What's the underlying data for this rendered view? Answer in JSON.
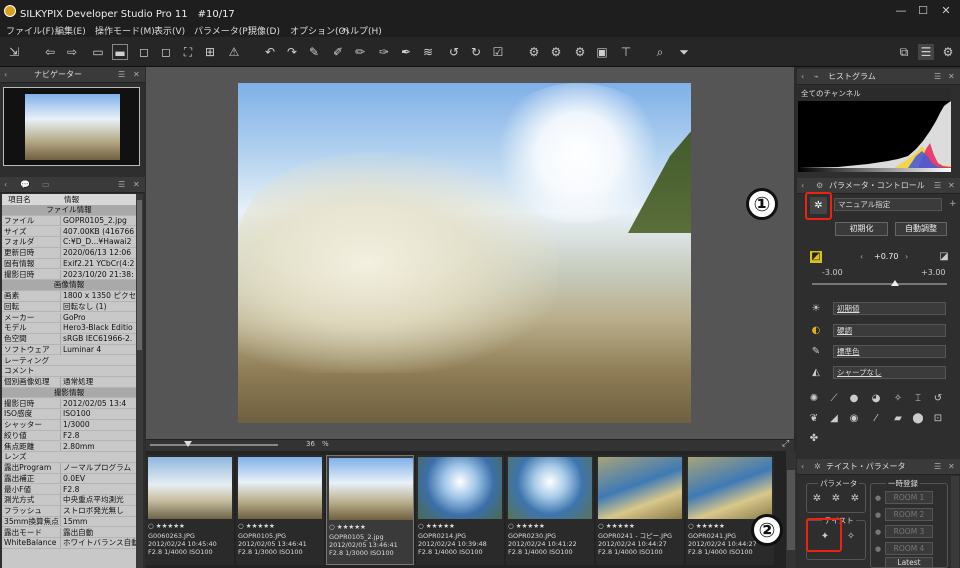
{
  "titlebar": {
    "title": "SILKYPIX Developer Studio Pro 11　#10/17",
    "minimize": "—",
    "maximize": "☐",
    "close": "✕"
  },
  "menu": [
    "ファイル(F)",
    "編集(E)",
    "操作モード(M)",
    "表示(V)",
    "パラメータ(P)",
    "現像(D)",
    "オプション(O)",
    "ヘルプ(H)"
  ],
  "navigator": {
    "title": "ナビゲーター"
  },
  "info": {
    "tabs_icon": "💬",
    "header_key": "項目名",
    "header_val": "情報",
    "rows": [
      {
        "section": "ファイル情報"
      },
      {
        "k": "ファイル",
        "v": "GOPR0105_2.jpg"
      },
      {
        "k": "サイズ",
        "v": "407.00KB (416766"
      },
      {
        "k": "フォルダ",
        "v": "C:¥D_D...¥Hawai2"
      },
      {
        "k": "更新日時",
        "v": "2020/06/13 12:06"
      },
      {
        "k": "固有情報",
        "v": "Exif2.21 YCbCr(4:2"
      },
      {
        "k": "撮影日時",
        "v": "2023/10/20 21:38:"
      },
      {
        "section": "画像情報"
      },
      {
        "k": "画素",
        "v": "1800 x 1350 ピクセ"
      },
      {
        "k": "回転",
        "v": "回転なし (1)"
      },
      {
        "k": "メーカー",
        "v": "GoPro"
      },
      {
        "k": "モデル",
        "v": "Hero3-Black Editio"
      },
      {
        "k": "色空間",
        "v": "sRGB IEC61966-2."
      },
      {
        "k": "ソフトウェア",
        "v": "Luminar 4"
      },
      {
        "k": "レーティング",
        "v": ""
      },
      {
        "k": "コメント",
        "v": ""
      },
      {
        "k": "個別画像処理",
        "v": "通常処理"
      },
      {
        "section": "撮影情報"
      },
      {
        "k": "撮影日時",
        "v": "2012/02/05 13:4"
      },
      {
        "k": "ISO感度",
        "v": "ISO100"
      },
      {
        "k": "シャッター",
        "v": "1/3000"
      },
      {
        "k": "絞り値",
        "v": "F2.8"
      },
      {
        "k": "焦点距離",
        "v": "2.80mm"
      },
      {
        "k": "レンズ",
        "v": ""
      },
      {
        "k": "露出Program",
        "v": "ノーマルプログラム"
      },
      {
        "k": "露出補正",
        "v": "0.0EV"
      },
      {
        "k": "最小F値",
        "v": "F2.8"
      },
      {
        "k": "測光方式",
        "v": "中央重点平均測光"
      },
      {
        "k": "フラッシュ",
        "v": "ストロボ発光無し"
      },
      {
        "k": "35mm換算焦点",
        "v": "15mm"
      },
      {
        "k": "露出モード",
        "v": "露出自動"
      },
      {
        "k": "WhiteBalance",
        "v": "ホワイトバランス自動"
      }
    ]
  },
  "viewer": {
    "zoom": "36",
    "zoom_unit": "%"
  },
  "filmstrip": [
    {
      "name": "G0060263.JPG",
      "date": "2012/02/24 10:45:40",
      "exif": "F2.8 1/4000 ISO100",
      "rating": "○ ★★★★★"
    },
    {
      "name": "GOPR0105.JPG",
      "date": "2012/02/05 13:46:41",
      "exif": "F2.8 1/3000 ISO100",
      "rating": "○ ★★★★★"
    },
    {
      "name": "GOPR0105_2.jpg",
      "date": "2012/02/05 13:46:41",
      "exif": "F2.8 1/3000 ISO100",
      "rating": "○ ★★★★★"
    },
    {
      "name": "GOPR0214.JPG",
      "date": "2012/02/24 10:39:48",
      "exif": "F2.8 1/4000 ISO100",
      "rating": "○ ★★★★★"
    },
    {
      "name": "GOPR0230.JPG",
      "date": "2012/02/24 10:41:22",
      "exif": "F2.8 1/4000 ISO100",
      "rating": "○ ★★★★★"
    },
    {
      "name": "GOPR0241 - コピー.JPG",
      "date": "2012/02/24 10:44:27",
      "exif": "F2.8 1/4000 ISO100",
      "rating": "○ ★★★★★"
    },
    {
      "name": "GOPR0241.JPG",
      "date": "2012/02/24 10:44:27",
      "exif": "F2.8 1/4000 ISO100",
      "rating": "○ ★★★★★"
    }
  ],
  "histogram": {
    "title": "ヒストグラム",
    "channel": "全てのチャンネル"
  },
  "params": {
    "title": "パラメータ・コントロール",
    "mode": "マニュアル指定",
    "init_btn": "初期化",
    "auto_btn": "自動調整",
    "exposure_value": "+0.70",
    "exposure_min": "-3.00",
    "exposure_max": "+3.00",
    "exposure_level": 0.617,
    "wb": "初期値",
    "tone": "硬調",
    "color": "標準色",
    "sharp": "シャープなし"
  },
  "taste": {
    "title": "テイスト・パラメータ",
    "group_param": "パラメータ",
    "group_taste": "テイスト",
    "group_temp": "一時登録",
    "rooms": [
      "ROOM 1",
      "ROOM 2",
      "ROOM 3",
      "ROOM 4"
    ],
    "latest": "Latest"
  },
  "badges": {
    "one": "①",
    "two": "②"
  }
}
